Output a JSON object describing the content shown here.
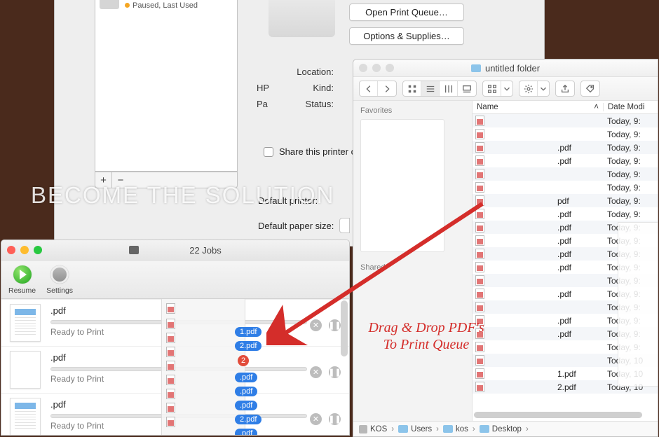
{
  "prefs": {
    "printer_status": "Paused, Last Used",
    "btn_open_queue": "Open Print Queue…",
    "btn_options": "Options & Supplies…",
    "labels": {
      "location": "Location:",
      "kind": "Kind:",
      "status": "Status:"
    },
    "values": {
      "location": "",
      "kind": "HP",
      "status": "Pa"
    },
    "share_label": "Share this printer o",
    "default_printer_label": "Default printer:",
    "default_paper_label": "Default paper size:",
    "plus": "+",
    "minus": "−"
  },
  "watermark": "BECOME THE SOLUTION",
  "queue": {
    "title_jobcount": "22 Jobs",
    "tool_resume": "Resume",
    "tool_settings": "Settings",
    "jobs": [
      {
        "name": ".pdf",
        "status": "Ready to Print"
      },
      {
        "name": ".pdf",
        "status": "Ready to Print"
      },
      {
        "name": ".pdf",
        "status": "Ready to Print"
      }
    ],
    "ghost": [
      "1.pdf",
      "2.pdf",
      "2",
      ".pdf",
      ".pdf",
      ".pdf",
      "2.pdf",
      ".pdf"
    ]
  },
  "finder": {
    "title": "untitled folder",
    "sidebar": {
      "favorites": "Favorites",
      "shared": "Shared"
    },
    "columns": {
      "name": "Name",
      "date": "Date Modi"
    },
    "rows": [
      {
        "name": "",
        "date": "Today, 9:"
      },
      {
        "name": "",
        "date": "Today, 9:"
      },
      {
        "name": ".pdf",
        "date": "Today, 9:"
      },
      {
        "name": ".pdf",
        "date": "Today, 9:"
      },
      {
        "name": "",
        "date": "Today, 9:"
      },
      {
        "name": "",
        "date": "Today, 9:"
      },
      {
        "name": "pdf",
        "date": "Today, 9:"
      },
      {
        "name": ".pdf",
        "date": "Today, 9:"
      },
      {
        "name": ".pdf",
        "date": "Today, 9:"
      },
      {
        "name": ".pdf",
        "date": "Today, 9:"
      },
      {
        "name": ".pdf",
        "date": "Today, 9:"
      },
      {
        "name": ".pdf",
        "date": "Today, 9:"
      },
      {
        "name": "",
        "date": "Today, 9:"
      },
      {
        "name": ".pdf",
        "date": "Today, 9:"
      },
      {
        "name": "",
        "date": "Today, 9:"
      },
      {
        "name": ".pdf",
        "date": "Today, 9:"
      },
      {
        "name": ".pdf",
        "date": "Today, 9:"
      },
      {
        "name": "",
        "date": "Today, 9:"
      },
      {
        "name": "",
        "date": "Today, 10"
      },
      {
        "name": "1.pdf",
        "date": "Today, 10"
      },
      {
        "name": "2.pdf",
        "date": "Today, 10"
      }
    ],
    "path": [
      "KOS",
      "Users",
      "kos",
      "Desktop"
    ]
  },
  "annotation": {
    "line1": "Drag & Drop PDF's",
    "line2": "To Print Queue"
  }
}
